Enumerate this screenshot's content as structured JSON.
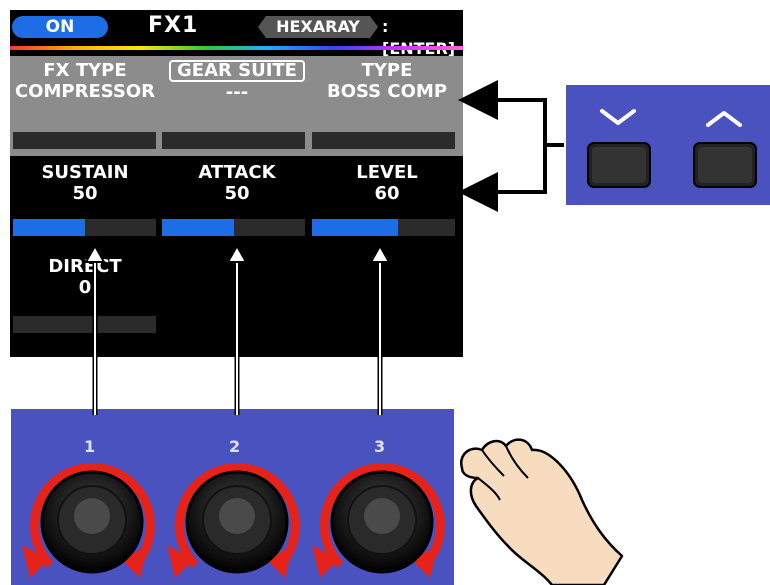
{
  "screen": {
    "on_label": "ON",
    "title": "FX1",
    "hexaray_label": "HEXARAY",
    "enter_label": ":[ENTER]"
  },
  "top_params": [
    {
      "label": "FX TYPE",
      "value": "COMPRESSOR"
    },
    {
      "label": "GEAR SUITE",
      "value": "---"
    },
    {
      "label": "TYPE",
      "value": "BOSS COMP"
    }
  ],
  "params": [
    {
      "label": "SUSTAIN",
      "value": "50",
      "level_percent": 50
    },
    {
      "label": "ATTACK",
      "value": "50",
      "level_percent": 50
    },
    {
      "label": "LEVEL",
      "value": "60",
      "level_percent": 60
    },
    {
      "label": "DIRECT",
      "value": "0",
      "level_percent": 0
    }
  ],
  "knobs": [
    "1",
    "2",
    "3"
  ],
  "buttons": {
    "down_icon": "chevron-down-icon",
    "up_icon": "chevron-up-icon"
  },
  "colors": {
    "screen_bg": "#000000",
    "accent_blue": "#1d6ee6",
    "panel_blue": "#4a52c0",
    "rotation_arrow": "#e5231b"
  }
}
